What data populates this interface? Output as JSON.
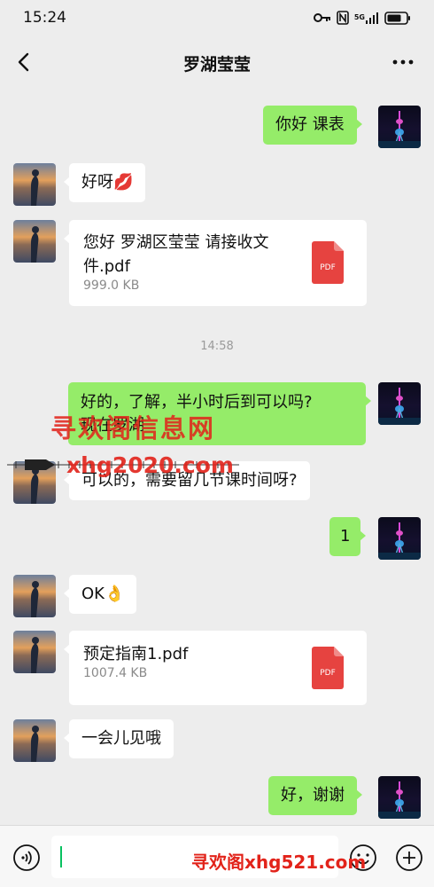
{
  "status_bar": {
    "time": "15:24",
    "network": "5G",
    "icons": [
      "key-icon",
      "nfc-icon",
      "signal-icon",
      "battery-icon"
    ]
  },
  "header": {
    "title": "罗湖莹莹",
    "back_icon": "chevron-left-icon",
    "more_icon": "more-dots-icon"
  },
  "messages": [
    {
      "from": "me",
      "text": "你好 课表"
    },
    {
      "from": "other",
      "text": "好呀💋"
    },
    {
      "from": "other",
      "type": "file",
      "name": "您好 罗湖区莹莹 请接收文件.pdf",
      "size": "999.0 KB",
      "icon_label": "PDF"
    },
    {
      "type": "time",
      "text": "14:58"
    },
    {
      "from": "me",
      "text": "好的，了解，半小时后到可以吗?",
      "text2": "现在罗湖"
    },
    {
      "from": "other",
      "text": "可以的，需要留几节课时间呀?"
    },
    {
      "from": "me",
      "text": "1"
    },
    {
      "from": "other",
      "text": "OK👌"
    },
    {
      "from": "other",
      "type": "file",
      "name": "预定指南1.pdf",
      "size": "1007.4 KB",
      "icon_label": "PDF"
    },
    {
      "from": "other",
      "text": "一会儿见哦"
    },
    {
      "from": "me",
      "text": "好，谢谢"
    }
  ],
  "watermarks": {
    "overlay_1": "寻欢阁信息网",
    "overlay_2": "xhg2020.com",
    "bottom": "寻欢阁xhg521.com"
  },
  "input_bar": {
    "voice_icon": "voice-icon",
    "emoji_icon": "emoji-icon",
    "plus_icon": "plus-icon",
    "value": ""
  },
  "colors": {
    "background": "#ededed",
    "my_bubble": "#95ec69",
    "their_bubble": "#ffffff",
    "pdf_red": "#e64340",
    "watermark_red": "#e2231a",
    "caret": "#07c160"
  }
}
